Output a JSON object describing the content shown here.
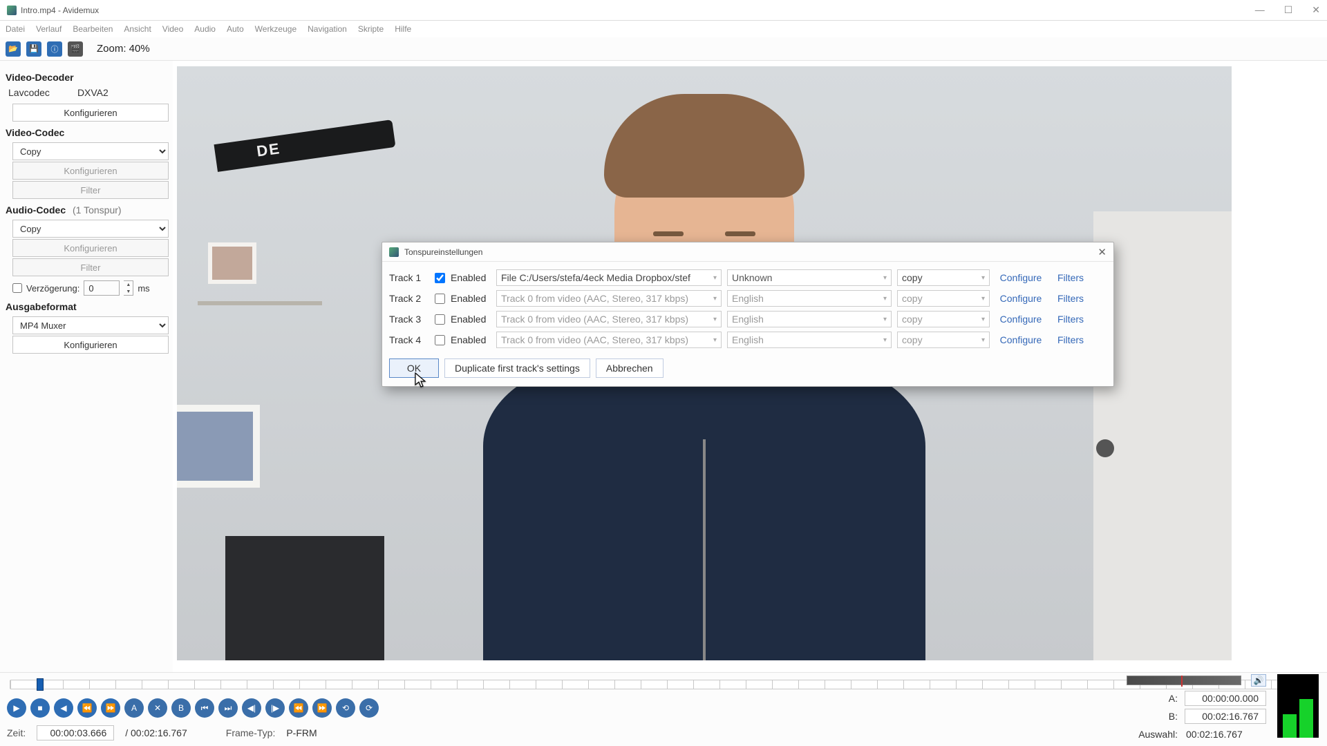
{
  "window": {
    "title": "Intro.mp4 - Avidemux"
  },
  "menu": [
    "Datei",
    "Verlauf",
    "Bearbeiten",
    "Ansicht",
    "Video",
    "Audio",
    "Auto",
    "Werkzeuge",
    "Navigation",
    "Skripte",
    "Hilfe"
  ],
  "toolbar": {
    "zoom_label": "Zoom: 40%"
  },
  "sidebar": {
    "decoder": {
      "title": "Video-Decoder",
      "col1": "Lavcodec",
      "col2": "DXVA2",
      "configure": "Konfigurieren"
    },
    "video_codec": {
      "title": "Video-Codec",
      "select": "Copy",
      "configure": "Konfigurieren",
      "filter": "Filter"
    },
    "audio_codec": {
      "title": "Audio-Codec",
      "hint": "(1 Tonspur)",
      "select": "Copy",
      "configure": "Konfigurieren",
      "filter": "Filter",
      "delay_label": "Verzögerung:",
      "delay_value": "0",
      "delay_unit": "ms"
    },
    "output": {
      "title": "Ausgabeformat",
      "select": "MP4 Muxer",
      "configure": "Konfigurieren"
    }
  },
  "dialog": {
    "title": "Tonspureinstellungen",
    "enabled_label": "Enabled",
    "configure": "Configure",
    "filters": "Filters",
    "tracks": [
      {
        "name": "Track 1",
        "enabled": true,
        "source": "File C:/Users/stefa/4eck Media Dropbox/stef",
        "language": "Unknown",
        "codec": "copy"
      },
      {
        "name": "Track 2",
        "enabled": false,
        "source": "Track 0 from video (AAC, Stereo, 317 kbps)",
        "language": "English",
        "codec": "copy"
      },
      {
        "name": "Track 3",
        "enabled": false,
        "source": "Track 0 from video (AAC, Stereo, 317 kbps)",
        "language": "English",
        "codec": "copy"
      },
      {
        "name": "Track 4",
        "enabled": false,
        "source": "Track 0 from video (AAC, Stereo, 317 kbps)",
        "language": "English",
        "codec": "copy"
      }
    ],
    "buttons": {
      "ok": "OK",
      "duplicate": "Duplicate first track's settings",
      "cancel": "Abbrechen"
    }
  },
  "status": {
    "time_label": "Zeit:",
    "time_value": "00:00:03.666",
    "duration": "/ 00:02:16.767",
    "frametype_label": "Frame-Typ:",
    "frametype_value": "P-FRM",
    "a_label": "A:",
    "a_value": "00:00:00.000",
    "b_label": "B:",
    "b_value": "00:02:16.767",
    "sel_label": "Auswahl:",
    "sel_value": "00:02:16.767"
  }
}
